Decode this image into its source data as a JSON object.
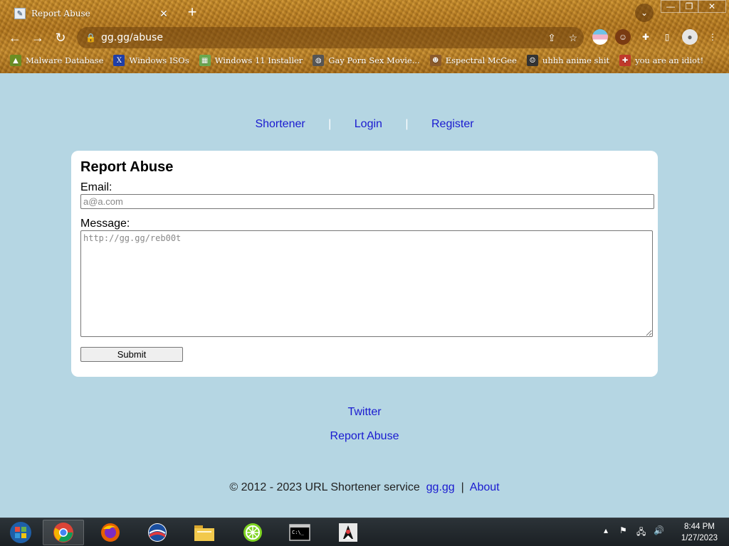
{
  "browser": {
    "tab_title": "Report Abuse",
    "tab_close": "✕",
    "new_tab": "+",
    "url": "gg.gg/abuse",
    "bookmarks": [
      {
        "label": "Malware Database",
        "icon": "malware-icon",
        "color": "#6b8e23"
      },
      {
        "label": "Windows ISOs",
        "icon": "x-icon",
        "color": "#1f3ea8"
      },
      {
        "label": "Windows 11 Installer",
        "icon": "installer-icon",
        "color": "#6aa84f"
      },
      {
        "label": "Gay Porn Sex Movie...",
        "icon": "globe-icon",
        "color": "#555555"
      },
      {
        "label": "Espectral McGee",
        "icon": "character-icon",
        "color": "#8b5a2b"
      },
      {
        "label": "uhhh anime shit",
        "icon": "anime-icon",
        "color": "#333333"
      },
      {
        "label": "you are an idiot!",
        "icon": "flag-icon",
        "color": "#c0392b"
      }
    ]
  },
  "nav": {
    "shortener": "Shortener",
    "login": "Login",
    "register": "Register",
    "separator": "|"
  },
  "form": {
    "title": "Report Abuse",
    "email_label": "Email:",
    "email_placeholder": "a@a.com",
    "message_label": "Message:",
    "message_placeholder": "http://gg.gg/reb00t",
    "submit_label": "Submit"
  },
  "footer": {
    "twitter": "Twitter",
    "report_abuse": "Report Abuse",
    "copyright": "© 2012 - 2023 URL Shortener service",
    "site_link": "gg.gg",
    "separator": "|",
    "about": "About"
  },
  "taskbar": {
    "time": "8:44 PM",
    "date": "1/27/2023"
  },
  "colors": {
    "page_bg": "#b5d6e3",
    "link": "#1a1ad0",
    "card_bg": "#ffffff"
  }
}
